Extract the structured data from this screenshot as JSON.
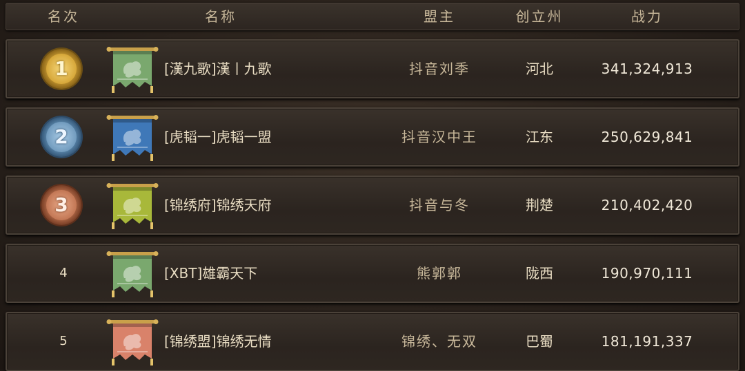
{
  "header": {
    "rank": "名次",
    "name": "名称",
    "leader": "盟主",
    "state": "创立州",
    "power": "战力"
  },
  "rows": [
    {
      "rank": "1",
      "medal": "gold",
      "banner_color": "#7aa86e",
      "banner_icon": "dragon-banner-icon",
      "name": "[漢九歌]漢丨九歌",
      "leader": "抖音刘季",
      "state": "河北",
      "power": "341,324,913"
    },
    {
      "rank": "2",
      "medal": "blue",
      "banner_color": "#3f78b8",
      "banner_icon": "dragon-banner-icon",
      "name": "[虎韬一]虎韬一盟",
      "leader": "抖音汉中王",
      "state": "江东",
      "power": "250,629,841"
    },
    {
      "rank": "3",
      "medal": "bronze",
      "banner_color": "#a8b83a",
      "banner_icon": "dragon-banner-icon",
      "name": "[锦绣府]锦绣天府",
      "leader": "抖音与冬",
      "state": "荆楚",
      "power": "210,402,420"
    },
    {
      "rank": "4",
      "medal": "none",
      "banner_color": "#7aa86e",
      "banner_icon": "dragon-banner-icon",
      "name": "[XBT]雄霸天下",
      "leader": "熊郭郭",
      "state": "陇西",
      "power": "190,970,111"
    },
    {
      "rank": "5",
      "medal": "none",
      "banner_color": "#d9826a",
      "banner_icon": "dragon-banner-icon",
      "name": "[锦绣盟]锦绣无情",
      "leader": "锦绣、无双",
      "state": "巴蜀",
      "power": "181,191,337"
    }
  ]
}
